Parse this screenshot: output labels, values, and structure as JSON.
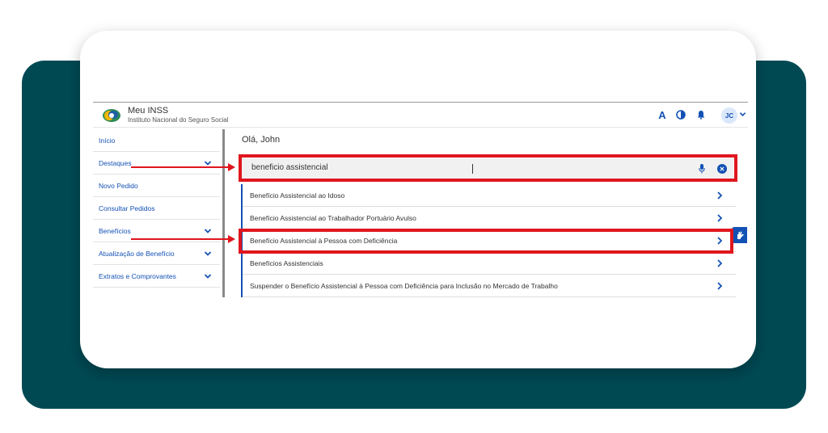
{
  "header": {
    "title": "Meu INSS",
    "subtitle": "Instituto Nacional do Seguro Social",
    "icons": [
      "font-size-icon",
      "contrast-icon",
      "bell-icon",
      "chevron-down-icon"
    ],
    "avatar_initials": "JC"
  },
  "sidebar": {
    "items": [
      {
        "label": "Início",
        "has_chevron": false
      },
      {
        "label": "Destaques",
        "has_chevron": true
      },
      {
        "label": "Novo Pedido",
        "has_chevron": false
      },
      {
        "label": "Consultar Pedidos",
        "has_chevron": false
      },
      {
        "label": "Benefícios",
        "has_chevron": true
      },
      {
        "label": "Atualização de Benefício",
        "has_chevron": true
      },
      {
        "label": "Extratos e Comprovantes",
        "has_chevron": true
      }
    ]
  },
  "main": {
    "greeting": "Olá, John",
    "search": {
      "value": "beneficio assistencial",
      "icons": [
        "microphone-icon",
        "clear-icon"
      ]
    },
    "results": [
      "Benefício Assistencial ao Idoso",
      "Benefício Assistencial ao Trabalhador Portuário Avulso",
      "Benefício Assistencial à Pessoa com Deficiência",
      "Benefícios Assistenciais",
      "Suspender o Benefício Assistencial à Pessoa com Deficiência para Inclusão no Mercado de Trabalho"
    ]
  },
  "accessibility_button": {
    "icon": "sign-language-hand-icon"
  },
  "colors": {
    "teal_background": "#004953",
    "accent_blue": "#1351b4",
    "highlight_red": "#e0161e",
    "search_bg": "#f1f1f1"
  }
}
